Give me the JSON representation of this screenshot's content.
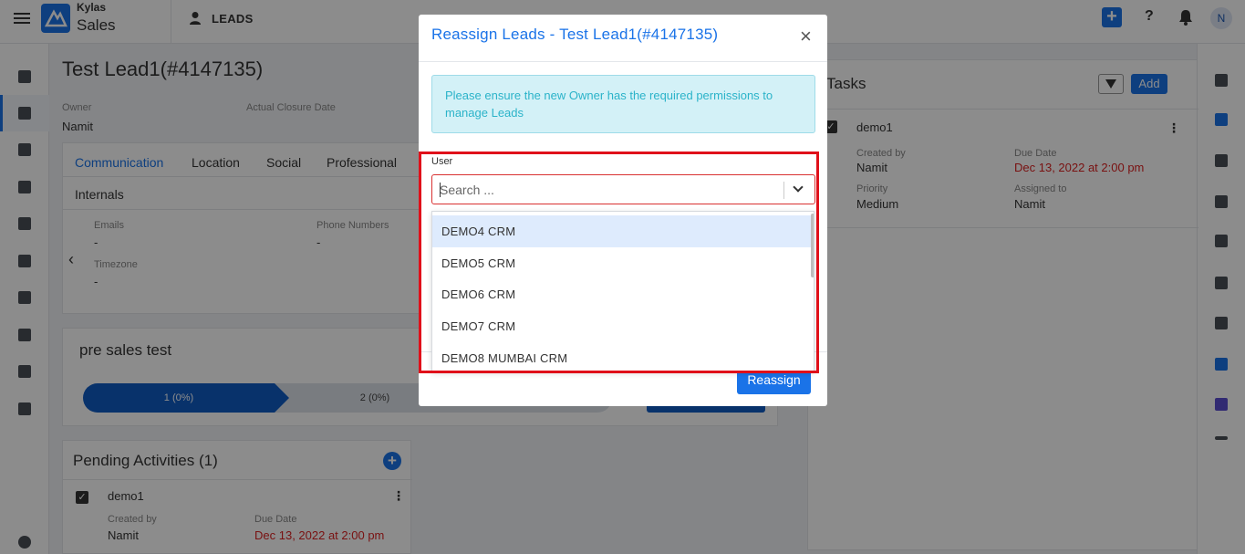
{
  "topbar": {
    "brand_top": "Kylas",
    "brand_main": "Sales",
    "module_label": "LEADS",
    "avatar_initial": "N",
    "help_symbol": "?",
    "plus_symbol": "+"
  },
  "lead": {
    "title": "Test Lead1(#4147135)",
    "owner_label": "Owner",
    "owner_value": "Namit",
    "closure_label": "Actual Closure Date"
  },
  "tabs": [
    "Communication",
    "Location",
    "Social",
    "Professional",
    "Internals"
  ],
  "communication": {
    "emails_label": "Emails",
    "emails_value": "-",
    "phone_label": "Phone Numbers",
    "phone_value": "-",
    "timezone_label": "Timezone",
    "timezone_value": "-",
    "prev_arrow": "‹"
  },
  "pipeline": {
    "title": "pre sales test",
    "stage1": "1 (0%)",
    "stage2": "2 (0%)"
  },
  "activities": {
    "title": "Pending Activities (1)",
    "add_symbol": "+",
    "item": {
      "name": "demo1",
      "created_by_label": "Created by",
      "created_by_value": "Namit",
      "due_date_label": "Due Date",
      "due_date_value": "Dec 13, 2022 at 2:00 pm"
    }
  },
  "tasks": {
    "title": "Tasks",
    "add_label": "Add",
    "item": {
      "name": "demo1",
      "created_by_label": "Created by",
      "created_by_value": "Namit",
      "due_date_label": "Due Date",
      "due_date_value": "Dec 13, 2022 at 2:00 pm",
      "priority_label": "Priority",
      "priority_value": "Medium",
      "assigned_label": "Assigned to",
      "assigned_value": "Namit"
    }
  },
  "modal": {
    "title": "Reassign Leads - Test Lead1(#4147135)",
    "close_symbol": "×",
    "alert": "Please ensure the new Owner has the required permissions to manage Leads",
    "field_label": "User",
    "search_placeholder": "Search ...",
    "reassign_label": "Reassign",
    "options": [
      "DEMO4 CRM",
      "DEMO5 CRM",
      "DEMO6 CRM",
      "DEMO7 CRM",
      "DEMO8 MUMBAI CRM"
    ]
  },
  "colors": {
    "accent": "#1a73e8",
    "highlight_frame": "#e0101a",
    "due_date": "#dd2222"
  }
}
